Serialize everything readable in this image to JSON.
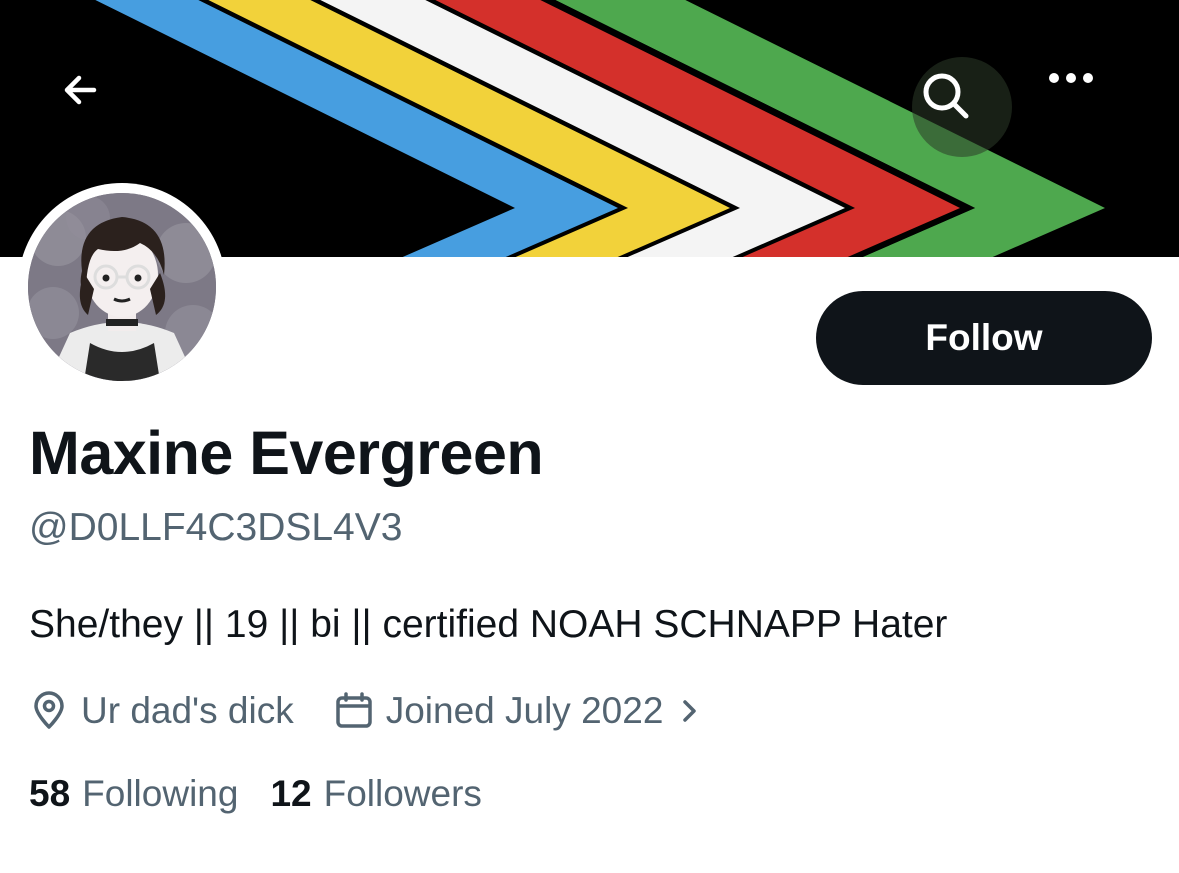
{
  "header": {
    "back_icon": "arrow-left-icon",
    "search_icon": "search-icon",
    "more_icon": "more-horizontal-icon",
    "banner_colors": [
      "#479ee0",
      "#f2d23a",
      "#f4f4f4",
      "#d4302b",
      "#4ea84e",
      "#000000"
    ]
  },
  "profile": {
    "display_name": "Maxine Evergreen",
    "handle": "@D0LLF4C3DSL4V3",
    "bio": "She/they || 19 || bi || certified NOAH SCHNAPP Hater",
    "location_icon": "location-pin-icon",
    "location": "Ur dad's dick",
    "joined_icon": "calendar-icon",
    "joined": "Joined July 2022",
    "joined_chevron_icon": "chevron-right-icon",
    "following_count": "58",
    "following_label": "Following",
    "followers_count": "12",
    "followers_label": "Followers"
  },
  "actions": {
    "follow_label": "Follow"
  },
  "colors": {
    "text_primary": "#0f1419",
    "text_secondary": "#536471",
    "button_dark": "#0f1419"
  }
}
